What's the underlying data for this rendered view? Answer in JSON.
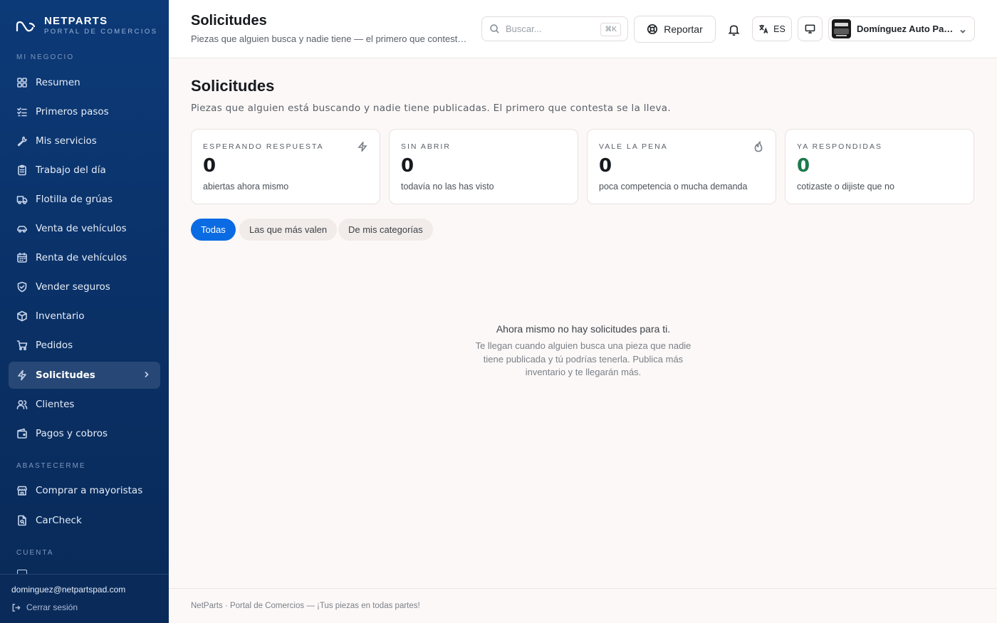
{
  "brand": {
    "name": "NETPARTS",
    "subtitle": "PORTAL DE COMERCIOS"
  },
  "sidebar": {
    "sections": [
      "MI NEGOCIO",
      "ABASTECERME",
      "CUENTA"
    ],
    "items": [
      {
        "label": "Resumen",
        "icon": "grid-icon"
      },
      {
        "label": "Primeros pasos",
        "icon": "checklist-icon"
      },
      {
        "label": "Mis servicios",
        "icon": "wrench-icon"
      },
      {
        "label": "Trabajo del día",
        "icon": "clipboard-icon"
      },
      {
        "label": "Flotilla de grúas",
        "icon": "truck-icon"
      },
      {
        "label": "Venta de vehículos",
        "icon": "car-icon"
      },
      {
        "label": "Renta de vehículos",
        "icon": "calendar-icon"
      },
      {
        "label": "Vender seguros",
        "icon": "shield-icon"
      },
      {
        "label": "Inventario",
        "icon": "box-icon"
      },
      {
        "label": "Pedidos",
        "icon": "cart-icon"
      },
      {
        "label": "Solicitudes",
        "icon": "bolt-icon",
        "active": true
      },
      {
        "label": "Clientes",
        "icon": "users-icon"
      },
      {
        "label": "Pagos y cobros",
        "icon": "wallet-icon"
      },
      {
        "label": "Comprar a mayoristas",
        "icon": "store-icon"
      },
      {
        "label": "CarCheck",
        "icon": "file-search-icon"
      }
    ],
    "footer": {
      "email": "dominguez@netpartspad.com",
      "logout": "Cerrar sesión"
    }
  },
  "header": {
    "title": "Solicitudes",
    "subtitle": "Piezas que alguien busca y nadie tiene — el primero que contesta se la lleva.",
    "search_placeholder": "Buscar...",
    "search_shortcut": "⌘K",
    "report_label": "Reportar",
    "language": "ES",
    "account_name": "Domínguez Auto Partes"
  },
  "main": {
    "title": "Solicitudes",
    "subtitle": "Piezas que alguien está buscando y nadie tiene publicadas. El primero que contesta se la lleva.",
    "cards": [
      {
        "label": "ESPERANDO RESPUESTA",
        "value": "0",
        "desc": "abiertas ahora mismo",
        "icon": "bolt-icon"
      },
      {
        "label": "SIN ABRIR",
        "value": "0",
        "desc": "todavía no las has visto"
      },
      {
        "label": "VALE LA PENA",
        "value": "0",
        "desc": "poca competencia o mucha demanda",
        "icon": "flame-icon"
      },
      {
        "label": "YA RESPONDIDAS",
        "value": "0",
        "desc": "cotizaste o dijiste que no",
        "value_color": "#1b7a4b"
      }
    ],
    "filters": [
      "Todas",
      "Las que más valen",
      "De mis categorías"
    ],
    "empty": {
      "title": "Ahora mismo no hay solicitudes para ti.",
      "subtitle": "Te llegan cuando alguien busca una pieza que nadie tiene publicada y tú podrías tenerla. Publica más inventario y te llegarán más."
    },
    "footer": "NetParts · Portal de Comercios — ¡Tus piezas en todas partes!"
  },
  "colors": {
    "sidebar": "#0c3a78",
    "accent": "#0a6be3",
    "success": "#1b7a4b"
  }
}
